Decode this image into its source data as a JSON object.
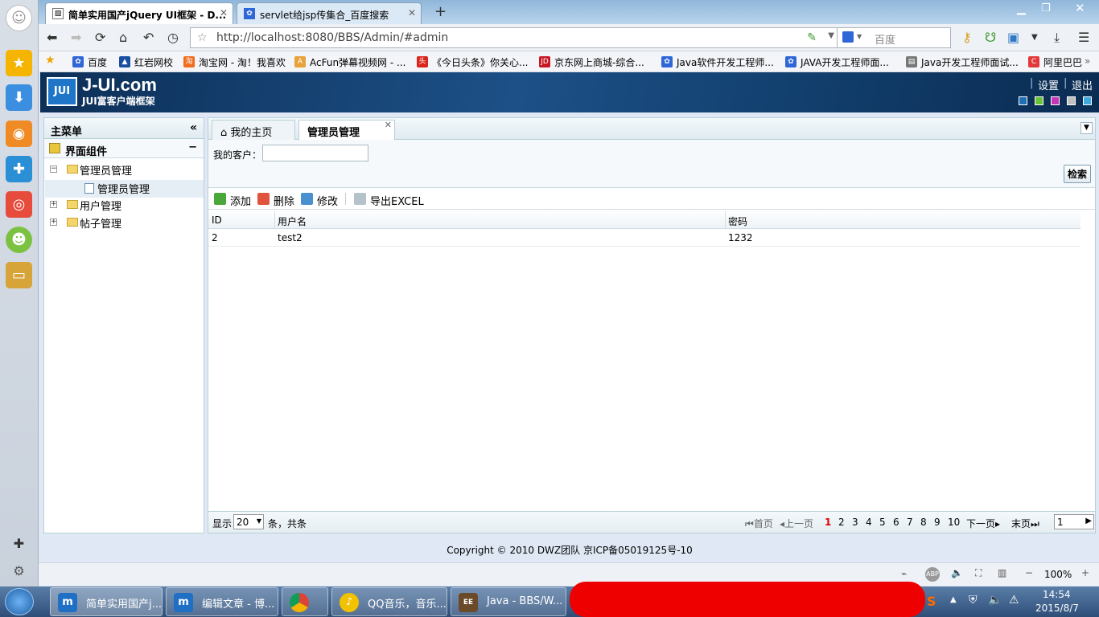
{
  "browser": {
    "tabs": [
      {
        "title": "简单实用国产jQuery UI框架 - D...",
        "icon": "page-icon"
      },
      {
        "title": "servlet给jsp传集合_百度搜索",
        "icon": "baidu-icon"
      }
    ],
    "url": "http://localhost:8080/BBS/Admin/#admin",
    "search_engine": "百度",
    "bookmarks": [
      "百度",
      "红岩网校",
      "淘宝网 - 淘！我喜欢",
      "AcFun弹幕视频网 - ...",
      "《今日头条》你关心...",
      "京东网上商城-综合...",
      "Java软件开发工程师...",
      "JAVA开发工程师面...",
      "Java开发工程师面试...",
      "阿里巴巴"
    ]
  },
  "app": {
    "logo_text": "JUI",
    "brand": "J-UI.com",
    "slogan": "JUI富客户端框架",
    "header_links": [
      "设置",
      "退出"
    ],
    "theme_colors": [
      "#1f6fb5",
      "#6ac13a",
      "#c436b6",
      "#c0c0c0",
      "#3fa9e0"
    ],
    "sidebar": {
      "title": "主菜单",
      "accordion": "界面组件",
      "tree": [
        {
          "label": "管理员管理",
          "children": [
            "管理员管理"
          ]
        },
        {
          "label": "用户管理"
        },
        {
          "label": "帖子管理"
        }
      ]
    },
    "tabs": [
      "我的主页",
      "管理员管理"
    ],
    "filter": {
      "label": "我的客户：",
      "value": "",
      "button": "检索"
    },
    "toolbar": [
      "添加",
      "删除",
      "修改",
      "导出EXCEL"
    ],
    "grid": {
      "columns": [
        "ID",
        "用户名",
        "密码"
      ],
      "rows": [
        [
          "2",
          "test2",
          "1232"
        ]
      ]
    },
    "pager": {
      "show": "显示",
      "page_size": "20",
      "suffix": "条，共条",
      "first": "首页",
      "prev": "上一页",
      "pages": [
        "1",
        "2",
        "3",
        "4",
        "5",
        "6",
        "7",
        "8",
        "9",
        "10"
      ],
      "current": "1",
      "next": "下一页",
      "last": "末页",
      "goto": "1"
    },
    "copyright": "Copyright © 2010 DWZ团队 京ICP备05019125号-10"
  },
  "statusbar": {
    "zoom": "100%"
  },
  "taskbar": {
    "items": [
      "简单实用国产j...",
      "编辑文章 - 博...",
      "",
      "QQ音乐，音乐...",
      "Java - BBS/W..."
    ],
    "time": "14:54",
    "date": "2015/8/7"
  }
}
